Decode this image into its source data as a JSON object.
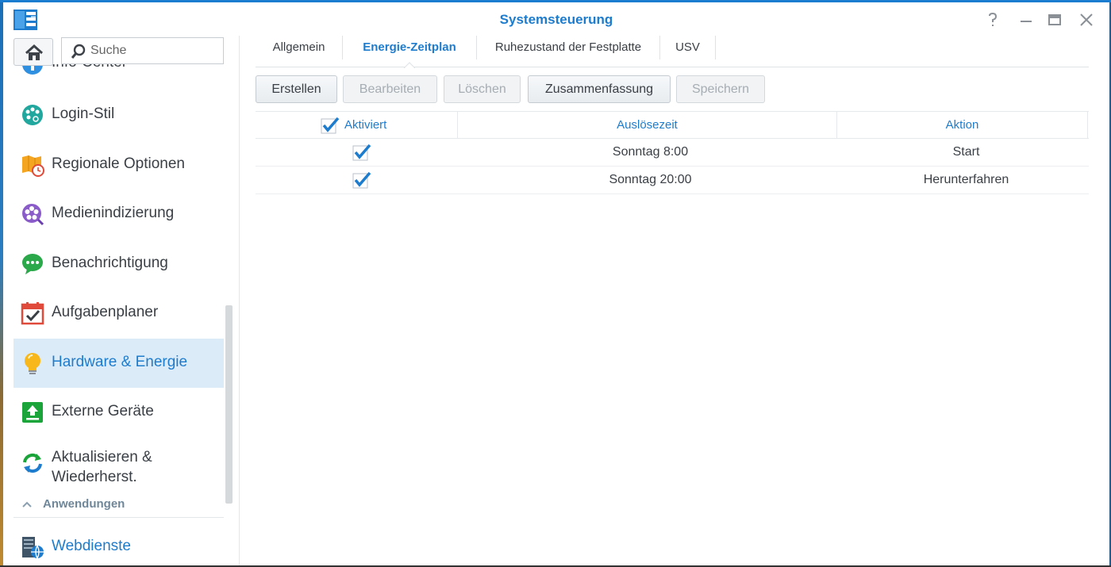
{
  "window": {
    "title": "Systemsteuerung",
    "controls": [
      "help-icon",
      "minimize-icon",
      "maximize-icon",
      "close-icon"
    ]
  },
  "sidebar": {
    "search": {
      "placeholder": "Suche",
      "value": ""
    },
    "partial_item": {
      "label": "Info-Center",
      "icon": "info-icon"
    },
    "items": [
      {
        "label": "Login-Stil",
        "icon": "palette-icon"
      },
      {
        "label": "Regionale Optionen",
        "icon": "map-clock-icon"
      },
      {
        "label": "Medienindizierung",
        "icon": "film-reel-icon"
      },
      {
        "label": "Benachrichtigung",
        "icon": "chat-bubble-icon"
      },
      {
        "label": "Aufgabenplaner",
        "icon": "calendar-check-icon"
      },
      {
        "label": "Hardware & Energie",
        "icon": "lightbulb-icon",
        "active": true
      },
      {
        "label": "Externe Geräte",
        "icon": "upload-device-icon"
      },
      {
        "label": "Aktualisieren & Wiederherst.",
        "icon": "refresh-icon"
      }
    ],
    "section": {
      "label": "Anwendungen",
      "icon": "chevron-up-icon"
    },
    "section_items": [
      {
        "label": "Webdienste",
        "icon": "web-server-icon"
      }
    ]
  },
  "tabs": [
    {
      "label": "Allgemein",
      "active": false
    },
    {
      "label": "Energie-Zeitplan",
      "active": true
    },
    {
      "label": "Ruhezustand der Festplatte",
      "active": false
    },
    {
      "label": "USV",
      "active": false
    }
  ],
  "toolbar": {
    "create": "Erstellen",
    "edit": "Bearbeiten",
    "delete": "Löschen",
    "summary": "Zusammenfassung",
    "save": "Speichern"
  },
  "table": {
    "columns": [
      "Aktiviert",
      "Auslösezeit",
      "Aktion"
    ],
    "rows": [
      {
        "enabled": true,
        "time": "Sonntag 8:00",
        "action": "Start"
      },
      {
        "enabled": true,
        "time": "Sonntag 20:00",
        "action": "Herunterfahren"
      }
    ]
  },
  "colors": {
    "accent": "#1d7ccd",
    "active_bg": "#dcebf8",
    "text": "#3a3f45",
    "disabled_text": "#a6adb3"
  }
}
